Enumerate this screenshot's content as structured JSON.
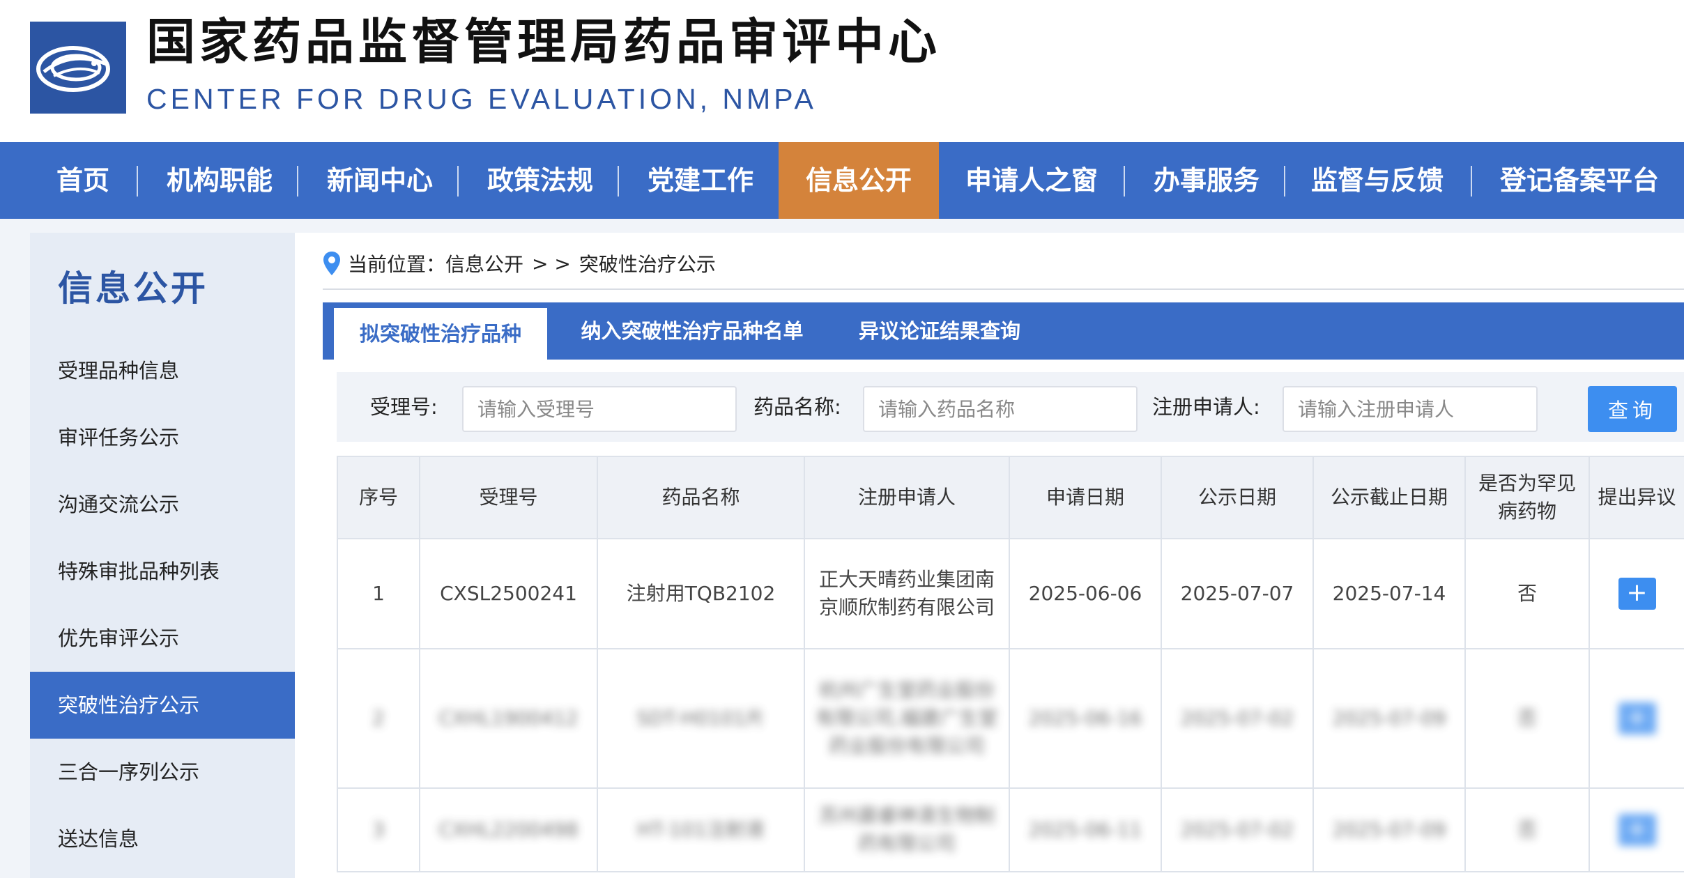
{
  "header": {
    "title_cn": "国家药品监督管理局药品审评中心",
    "title_en": "CENTER FOR DRUG EVALUATION, NMPA",
    "logo_icon": "cde-logo-icon"
  },
  "nav": {
    "items": [
      "首页",
      "机构职能",
      "新闻中心",
      "政策法规",
      "党建工作",
      "信息公开",
      "申请人之窗",
      "办事服务",
      "监督与反馈",
      "登记备案平台"
    ],
    "active": "信息公开",
    "colors": {
      "bar": "#3a6cc6",
      "active": "#d4833b"
    }
  },
  "sidebar": {
    "title": "信息公开",
    "items": [
      "受理品种信息",
      "审评任务公示",
      "沟通交流公示",
      "特殊审批品种列表",
      "优先审评公示",
      "突破性治疗公示",
      "三合一序列公示",
      "送达信息"
    ],
    "active": "突破性治疗公示"
  },
  "breadcrumb": {
    "prefix": "当前位置：信息公开",
    "separator": "> >",
    "current": "突破性治疗公示"
  },
  "tabs": [
    "拟突破性治疗品种",
    "纳入突破性治疗品种名单",
    "异议论证结果查询"
  ],
  "search": {
    "accept_no_label": "受理号:",
    "accept_no_placeholder": "请输入受理号",
    "drug_name_label": "药品名称:",
    "drug_name_placeholder": "请输入药品名称",
    "applicant_label": "注册申请人:",
    "applicant_placeholder": "请输入注册申请人",
    "button": "查询"
  },
  "table": {
    "headers": [
      "序号",
      "受理号",
      "药品名称",
      "注册申请人",
      "申请日期",
      "公示日期",
      "公示截止日期",
      "是否为罕见病药物",
      "提出异议"
    ],
    "rows": [
      [
        "1",
        "CXSL2500241",
        "注射用TQB2102",
        "正大天晴药业集团南京顺欣制药有限公司",
        "2025-06-06",
        "2025-07-07",
        "2025-07-14",
        "否",
        "+"
      ],
      [
        "2",
        "CXHL1900412",
        "SDT-H0101片",
        "杭州广生堂药业股份有限公司,福建广生堂药业股份有限公司",
        "2025-06-16",
        "2025-07-02",
        "2025-07-09",
        "否",
        "+"
      ],
      [
        "3",
        "CXHL2200498",
        "HT-101注射液",
        "苏州晨睿神清生物制药有限公司",
        "2025-06-11",
        "2025-07-02",
        "2025-07-09",
        "否",
        "+"
      ]
    ]
  }
}
